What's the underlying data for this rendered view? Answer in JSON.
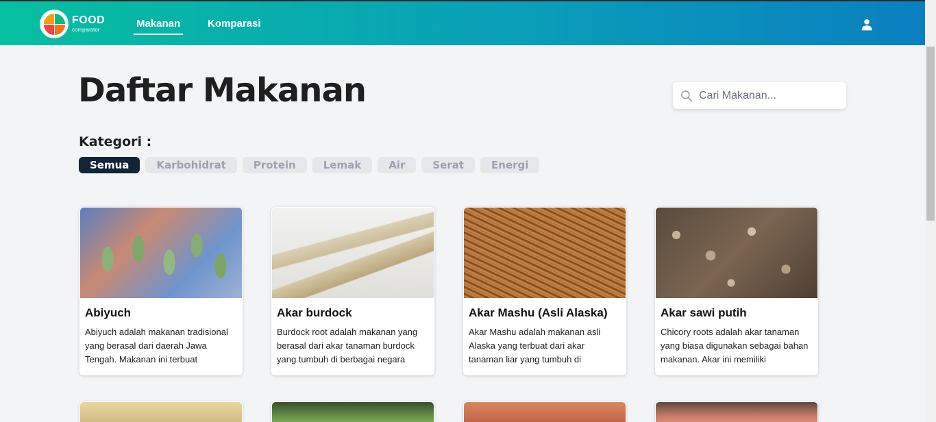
{
  "nav": {
    "brand_name": "FOOD",
    "brand_sub": "comparator",
    "links": [
      {
        "label": "Makanan",
        "active": true
      },
      {
        "label": "Komparasi",
        "active": false
      }
    ],
    "user_icon": "user-icon"
  },
  "main": {
    "title": "Daftar Makanan",
    "search": {
      "placeholder": "Cari Makanan...",
      "value": "",
      "icon": "search-icon"
    },
    "kategori_label": "Kategori :",
    "categories": [
      {
        "label": "Semua",
        "active": true
      },
      {
        "label": "Karbohidrat",
        "active": false
      },
      {
        "label": "Protein",
        "active": false
      },
      {
        "label": "Lemak",
        "active": false
      },
      {
        "label": "Air",
        "active": false
      },
      {
        "label": "Serat",
        "active": false
      },
      {
        "label": "Energi",
        "active": false
      }
    ],
    "foods": [
      {
        "name": "Abiyuch",
        "desc": "Abiyuch adalah makanan tradisional yang berasal dari daerah Jawa Tengah. Makanan ini terbuat"
      },
      {
        "name": "Akar burdock",
        "desc": "Burdock root adalah makanan yang berasal dari akar tanaman burdock yang tumbuh di berbagai negara"
      },
      {
        "name": "Akar Mashu (Asli Alaska)",
        "desc": "Akar Mashu adalah makanan asli Alaska yang terbuat dari akar tanaman liar yang tumbuh di"
      },
      {
        "name": "Akar sawi putih",
        "desc": "Chicory roots adalah akar tanaman yang biasa digunakan sebagai bahan makanan. Akar ini memiliki"
      }
    ]
  },
  "colors": {
    "nav_gradient_start": "#06bfa0",
    "nav_gradient_end": "#0a7fc0",
    "chip_active_bg": "#132436",
    "chip_inactive_bg": "#e5e7eb",
    "page_bg": "#f3f4f6"
  }
}
